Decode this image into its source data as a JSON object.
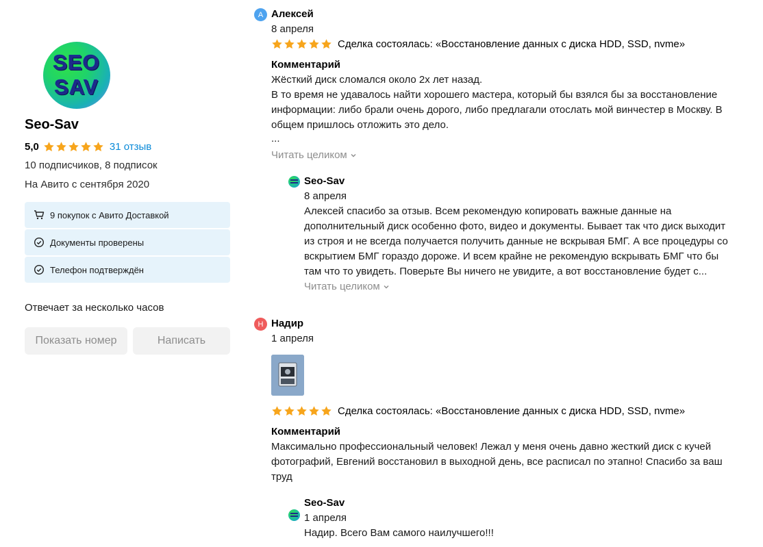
{
  "seller": {
    "logo_line1": "SEO",
    "logo_line2": "SAV",
    "name": "Seo-Sav",
    "rating": "5,0",
    "stars": 5,
    "reviews_link": "31 отзыв",
    "followers": "10 подписчиков, 8 подписок",
    "since": "На Авито с сентября 2020",
    "badges": [
      {
        "icon": "cart-icon",
        "label": "9 покупок с Авито Доставкой"
      },
      {
        "icon": "check-circle-icon",
        "label": "Документы проверены"
      },
      {
        "icon": "check-circle-icon",
        "label": "Телефон подтверждён"
      }
    ],
    "response_time": "Отвечает за несколько часов",
    "show_phone_button": "Показать номер",
    "write_button": "Написать"
  },
  "reviews": [
    {
      "avatar_letter": "А",
      "avatar_color": "#4ea3ef",
      "author": "Алексей",
      "date": "8 апреля",
      "stars": 5,
      "deal": "Сделка состоялась: «Восстановление данных с диска HDD, SSD, nvme»",
      "comment_label": "Комментарий",
      "text_lines": [
        "Жёсткий диск сломался около 2х лет назад.",
        "В то время не удавалось найти хорошего мастера, который бы взялся бы за восстановление",
        "информации: либо брали очень дорого, либо предлагали отослать мой винчестер в Москву. В",
        "общем пришлось отложить это дело.",
        "..."
      ],
      "read_more": "Читать целиком",
      "reply": {
        "author": "Seo-Sav",
        "date": "8 апреля",
        "text_lines": [
          "Алексей спасибо за отзыв. Всем рекомендую копировать важные данные на",
          "дополнительный диск особенно фото, видео и документы. Бывает так что диск выходит",
          "из строя и не всегда получается получить данные не вскрывая БМГ. А все процедуры со",
          "вскрытием БМГ гораздо дороже. И всем крайне не рекомендую вскрывать БМГ что бы",
          "там что то увидеть. Поверьте Вы ничего не увидите, а вот восстановление будет с..."
        ],
        "read_more": "Читать целиком"
      }
    },
    {
      "avatar_letter": "Н",
      "avatar_color": "#ef5b5b",
      "author": "Надир",
      "date": "1 апреля",
      "stars": 5,
      "deal": "Сделка состоялась: «Восстановление данных с диска HDD, SSD, nvme»",
      "comment_label": "Комментарий",
      "text_lines": [
        "Максимально профессиональный человек! Лежал у меня очень давно жесткий диск с кучей",
        "фотографий, Евгений восстановил в выходной день, все расписал по этапно! Спасибо за ваш",
        "труд"
      ],
      "reply": {
        "author": "Seo-Sav",
        "date": "1 апреля",
        "text_lines": [
          "Надир. Всего Вам самого наилучшего!!!"
        ]
      }
    }
  ],
  "colors": {
    "star": "#f7a51c",
    "link": "#0a8ad8",
    "badge_bg": "#e6f3fb",
    "button_bg": "#f2f2f2",
    "muted": "#8d8d8d"
  }
}
